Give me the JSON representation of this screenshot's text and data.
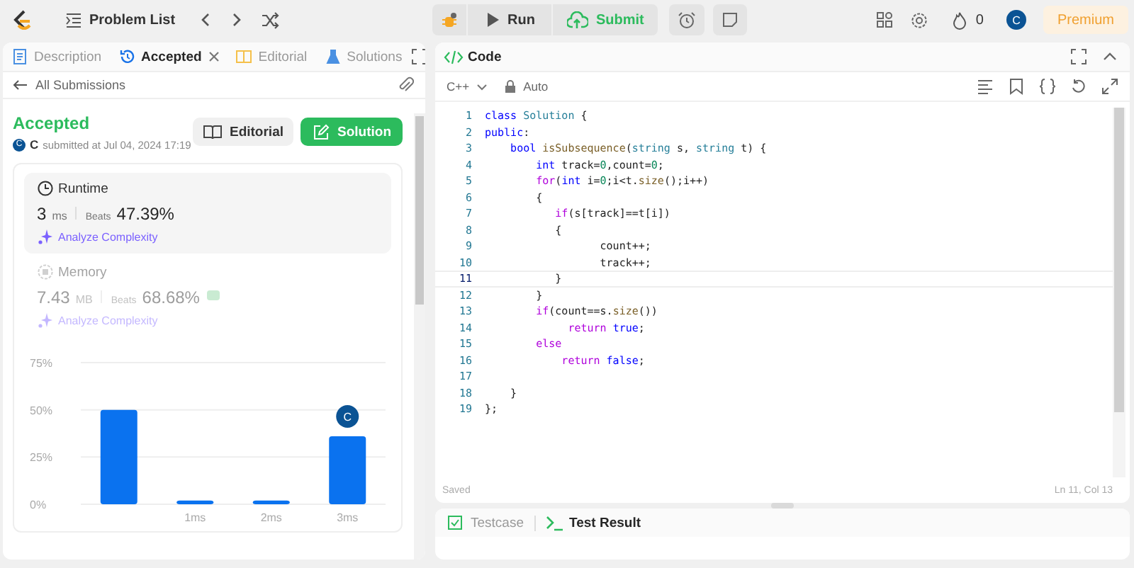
{
  "top_bar": {
    "problem_list": "Problem List",
    "run": "Run",
    "submit": "Submit",
    "streak": "0",
    "avatar": "C",
    "premium": "Premium"
  },
  "left_panel": {
    "tabs": [
      {
        "label": "Description",
        "selected": false,
        "closable": false
      },
      {
        "label": "Accepted",
        "selected": true,
        "closable": true
      },
      {
        "label": "Editorial",
        "selected": false,
        "closable": false
      },
      {
        "label": "Solutions",
        "selected": false,
        "closable": false
      }
    ],
    "back_link": "All Submissions",
    "status": "Accepted",
    "author_avatar": "C",
    "author": "C",
    "submitted": "submitted at Jul 04, 2024 17:19",
    "buttons": [
      {
        "label": "Editorial",
        "primary": false
      },
      {
        "label": "Solution",
        "primary": true
      }
    ],
    "stats": [
      {
        "title": "Runtime",
        "value": "3",
        "unit": "ms",
        "beats_label": "Beats",
        "beats": "47.39%",
        "analyze": "Analyze Complexity",
        "selected": true
      },
      {
        "title": "Memory",
        "value": "7.43",
        "unit": "MB",
        "beats_label": "Beats",
        "beats": "68.68%",
        "analyze": "Analyze Complexity",
        "selected": false
      }
    ],
    "chart_data": {
      "type": "bar",
      "categories": [
        null,
        "1ms",
        "2ms",
        "3ms"
      ],
      "series": [
        {
          "color": "#0a72ef",
          "values": [
            50,
            2,
            2,
            36
          ]
        }
      ],
      "ylim": [
        0,
        75
      ],
      "yticks": [
        {
          "value": 0,
          "label": "0%"
        },
        {
          "value": 25,
          "label": "25%"
        },
        {
          "value": 50,
          "label": "50%"
        },
        {
          "value": 75,
          "label": "75%"
        }
      ],
      "annotations": [
        {
          "x": "3ms",
          "text": "C"
        }
      ]
    }
  },
  "code_panel": {
    "title": "Code",
    "language": "C++",
    "mode": "Auto",
    "lines": [
      {
        "number": "1",
        "active": false,
        "tokens": [
          {
            "kind": "storage",
            "text": "class "
          },
          {
            "kind": "type",
            "text": "Solution"
          },
          {
            "kind": "plain",
            "text": " {"
          }
        ]
      },
      {
        "number": "2",
        "active": false,
        "tokens": [
          {
            "kind": "storage",
            "text": "public"
          },
          {
            "kind": "plain",
            "text": ":"
          }
        ]
      },
      {
        "number": "3",
        "active": false,
        "tokens": [
          {
            "kind": "storage",
            "text": "    bool "
          },
          {
            "kind": "function",
            "text": "isSubsequence"
          },
          {
            "kind": "plain",
            "text": "("
          },
          {
            "kind": "type",
            "text": "string"
          },
          {
            "kind": "plain",
            "text": " s, "
          },
          {
            "kind": "type",
            "text": "string"
          },
          {
            "kind": "plain",
            "text": " t) {"
          }
        ]
      },
      {
        "number": "4",
        "active": false,
        "tokens": [
          {
            "kind": "storage",
            "text": "        int"
          },
          {
            "kind": "plain",
            "text": " track="
          },
          {
            "kind": "number",
            "text": "0"
          },
          {
            "kind": "plain",
            "text": ",count="
          },
          {
            "kind": "number",
            "text": "0"
          },
          {
            "kind": "plain",
            "text": ";"
          }
        ]
      },
      {
        "number": "5",
        "active": false,
        "tokens": [
          {
            "kind": "keyword",
            "text": "        for"
          },
          {
            "kind": "plain",
            "text": "("
          },
          {
            "kind": "storage",
            "text": "int"
          },
          {
            "kind": "plain",
            "text": " i="
          },
          {
            "kind": "number",
            "text": "0"
          },
          {
            "kind": "plain",
            "text": ";i<t."
          },
          {
            "kind": "function",
            "text": "size"
          },
          {
            "kind": "plain",
            "text": "();i++)"
          }
        ]
      },
      {
        "number": "6",
        "active": false,
        "tokens": [
          {
            "kind": "plain",
            "text": "        {"
          }
        ]
      },
      {
        "number": "7",
        "active": false,
        "tokens": [
          {
            "kind": "keyword",
            "text": "           if"
          },
          {
            "kind": "plain",
            "text": "(s[track]==t[i])"
          }
        ]
      },
      {
        "number": "8",
        "active": false,
        "tokens": [
          {
            "kind": "plain",
            "text": "           {"
          }
        ]
      },
      {
        "number": "9",
        "active": false,
        "tokens": [
          {
            "kind": "plain",
            "text": "                  count++;"
          }
        ]
      },
      {
        "number": "10",
        "active": false,
        "tokens": [
          {
            "kind": "plain",
            "text": "                  track++;"
          }
        ]
      },
      {
        "number": "11",
        "active": true,
        "tokens": [
          {
            "kind": "plain",
            "text": "           }"
          }
        ]
      },
      {
        "number": "12",
        "active": false,
        "tokens": [
          {
            "kind": "plain",
            "text": "        }"
          }
        ]
      },
      {
        "number": "13",
        "active": false,
        "tokens": [
          {
            "kind": "keyword",
            "text": "        if"
          },
          {
            "kind": "plain",
            "text": "(count==s."
          },
          {
            "kind": "function",
            "text": "size"
          },
          {
            "kind": "plain",
            "text": "())"
          }
        ]
      },
      {
        "number": "14",
        "active": false,
        "tokens": [
          {
            "kind": "keyword",
            "text": "             return "
          },
          {
            "kind": "storage",
            "text": "true"
          },
          {
            "kind": "plain",
            "text": ";"
          }
        ]
      },
      {
        "number": "15",
        "active": false,
        "tokens": [
          {
            "kind": "keyword",
            "text": "        else"
          }
        ]
      },
      {
        "number": "16",
        "active": false,
        "tokens": [
          {
            "kind": "keyword",
            "text": "            return "
          },
          {
            "kind": "storage",
            "text": "false"
          },
          {
            "kind": "plain",
            "text": ";"
          }
        ]
      },
      {
        "number": "17",
        "active": false
      },
      {
        "number": "18",
        "active": false,
        "tokens": [
          {
            "kind": "plain",
            "text": "    }"
          }
        ]
      },
      {
        "number": "19",
        "active": false,
        "tokens": [
          {
            "kind": "plain",
            "text": "};"
          }
        ]
      }
    ],
    "status": "Saved",
    "cursor": "Ln 11, Col 13"
  },
  "bottom_panel": {
    "tabs": [
      {
        "label": "Testcase",
        "selected": false
      },
      {
        "label": "Test Result",
        "selected": true
      }
    ]
  }
}
